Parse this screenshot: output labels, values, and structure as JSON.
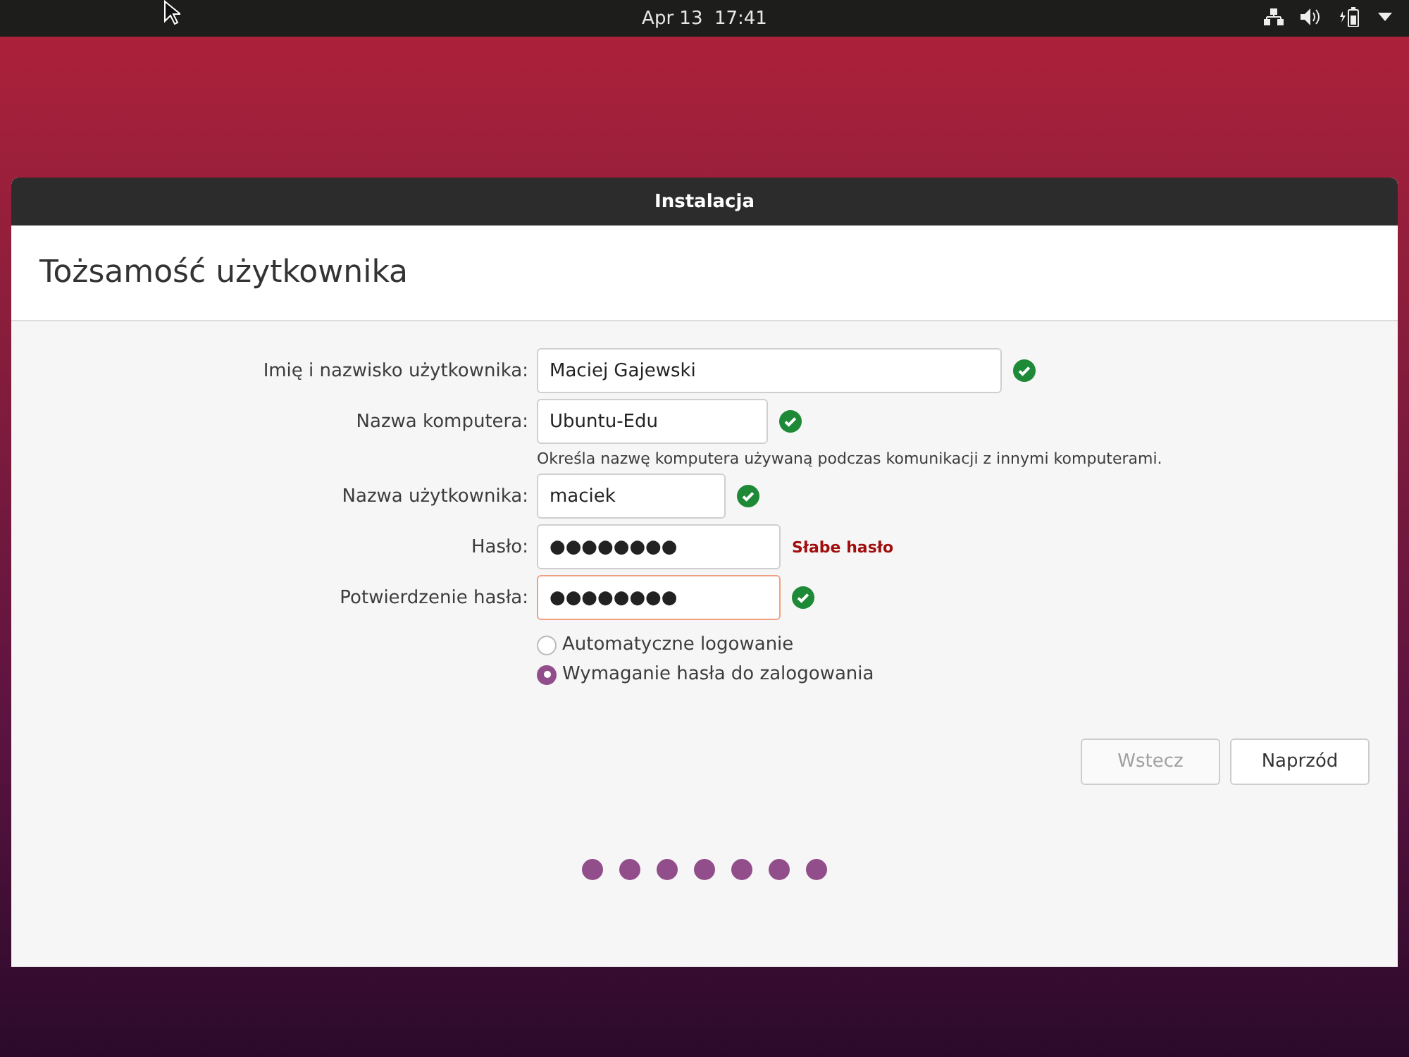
{
  "top_bar": {
    "clock": "Apr 13  17:41"
  },
  "window": {
    "title": "Instalacja",
    "heading": "Tożsamość użytkownika"
  },
  "fields": [
    {
      "label": "Imię i nazwisko użytkownika:",
      "value": "Maciej Gajewski",
      "kind": "wide",
      "focused": false,
      "valid": true
    },
    {
      "label": "Nazwa komputera:",
      "value": "Ubuntu-Edu",
      "kind": "medium",
      "focused": false,
      "valid": true,
      "hint": "Określa nazwę komputera używaną podczas komunikacji z innymi komputerami."
    },
    {
      "label": "Nazwa użytkownika:",
      "value": "maciek",
      "kind": "narrow",
      "focused": false,
      "valid": true
    },
    {
      "label": "Hasło:",
      "value": "●●●●●●●●",
      "kind": "password",
      "focused": false,
      "valid": false,
      "message": "Słabe hasło"
    },
    {
      "label": "Potwierdzenie hasła:",
      "value": "●●●●●●●●",
      "kind": "password",
      "focused": true,
      "valid": true
    }
  ],
  "login_options": [
    {
      "label": "Automatyczne logowanie",
      "selected": false
    },
    {
      "label": "Wymaganie hasła do zalogowania",
      "selected": true
    }
  ],
  "buttons": [
    {
      "label": "Wstecz",
      "disabled": true
    },
    {
      "label": "Naprzód",
      "disabled": false
    }
  ]
}
